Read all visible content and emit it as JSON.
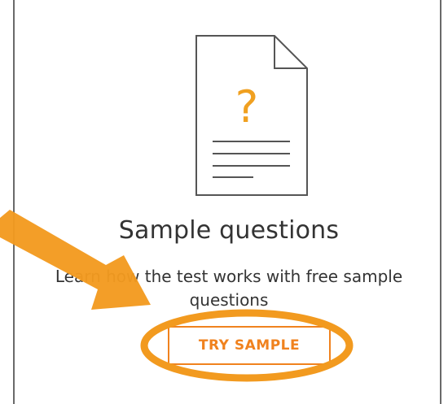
{
  "card": {
    "icon": "document-question-icon",
    "icon_glyph": "?",
    "title": "Sample questions",
    "description": "Learn how the test works with free sample questions",
    "button_label": "TRY SAMPLE"
  },
  "colors": {
    "accent": "#f0821e",
    "annotation": "#f29a1f",
    "text": "#333333",
    "border": "#6a6a6a"
  },
  "annotations": {
    "arrow": "orange-arrow-pointing-to-button",
    "highlight": "orange-ellipse-around-button"
  }
}
